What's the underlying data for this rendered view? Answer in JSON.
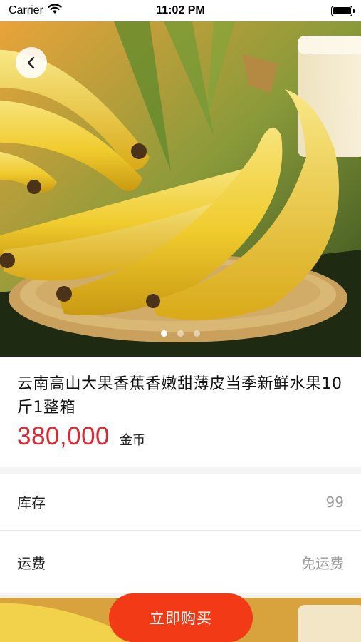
{
  "status_bar": {
    "carrier": "Carrier",
    "time": "11:02 PM",
    "battery_level": 1.0
  },
  "carousel": {
    "image": "banana-bunch-on-bamboo-basket",
    "slide_count": 3,
    "active_index": 0
  },
  "product": {
    "title": "云南高山大果香蕉香嫩甜薄皮当季新鲜水果10斤1整箱",
    "price": "380,000",
    "unit": "金币"
  },
  "specs": {
    "stock_label": "库存",
    "stock_value": "99",
    "freight_label": "运费",
    "freight_value": "免运费"
  },
  "actions": {
    "buy_label": "立即购买"
  },
  "colors": {
    "price": "#e5232f",
    "buy_button": "#f23a16"
  },
  "icons": {
    "back": "chevron-left-icon",
    "wifi": "wifi-icon",
    "battery": "battery-icon"
  }
}
